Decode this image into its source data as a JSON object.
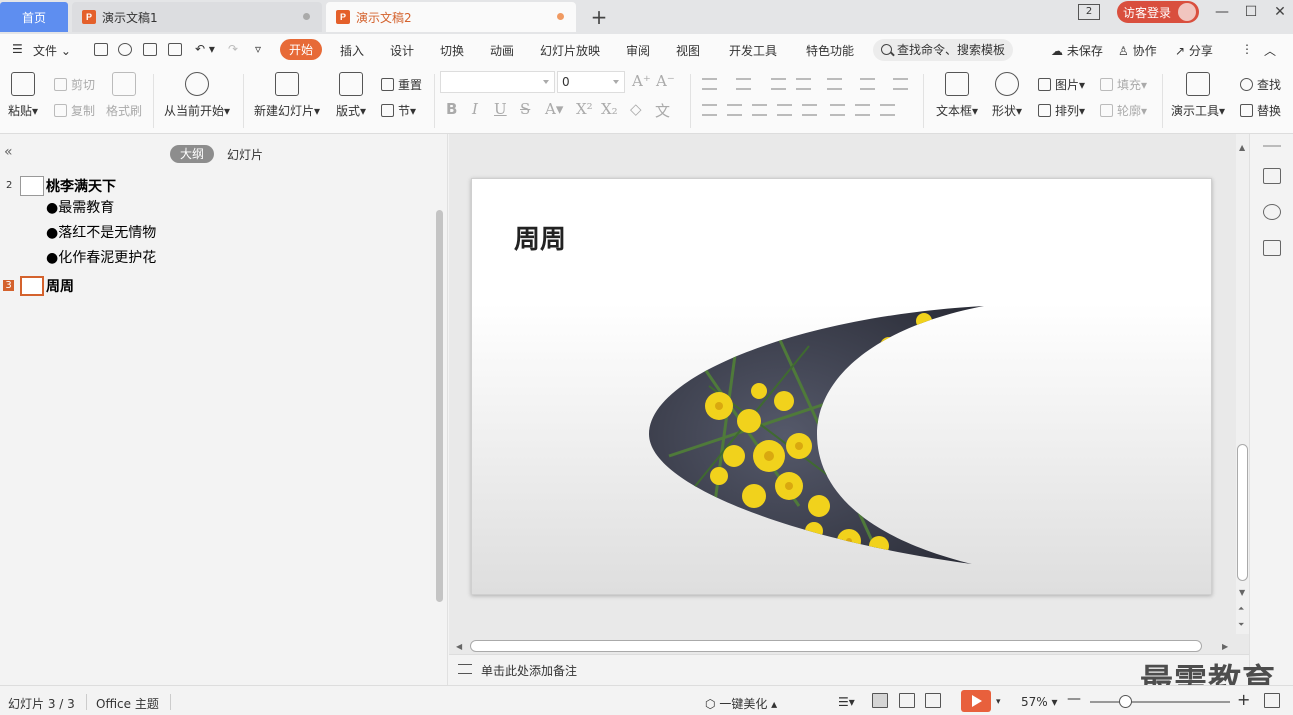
{
  "titlebar": {
    "home_tab": "首页",
    "tabs": [
      {
        "label": "演示文稿1",
        "icon": "presentation-icon"
      },
      {
        "label": "演示文稿2",
        "icon": "presentation-icon"
      }
    ],
    "add_tab": "+",
    "window_count": "2",
    "login": "访客登录"
  },
  "menu": {
    "file": "文件",
    "items": [
      "开始",
      "插入",
      "设计",
      "切换",
      "动画",
      "幻灯片放映",
      "审阅",
      "视图",
      "开发工具",
      "特色功能"
    ],
    "active": "开始",
    "search_placeholder": "查找命令、搜索模板",
    "unsaved": "未保存",
    "collaborate": "协作",
    "share": "分享"
  },
  "ribbon": {
    "paste": "粘贴",
    "cut": "剪切",
    "copy": "复制",
    "format_painter": "格式刷",
    "from_current": "从当前开始",
    "new_slide": "新建幻灯片",
    "layout": "版式",
    "reset": "重置",
    "section": "节",
    "font_name": "",
    "font_size": "0",
    "text_box": "文本框",
    "shape": "形状",
    "picture": "图片",
    "arrange": "排列",
    "fill": "填充",
    "outline": "轮廓",
    "present_tools": "演示工具",
    "find": "查找",
    "replace": "替换"
  },
  "outline": {
    "tab_outline": "大纲",
    "tab_slides": "幻灯片",
    "slides": [
      {
        "num": "2",
        "title": "桃李满天下",
        "bullets": [
          "●最需教育",
          "●落红不是无情物",
          "●化作春泥更护花"
        ]
      },
      {
        "num": "3",
        "title": "周周",
        "bullets": []
      }
    ]
  },
  "slide": {
    "title": "周周"
  },
  "notes": {
    "placeholder": "单击此处添加备注"
  },
  "watermark": "最需教育",
  "status": {
    "slide_info": "幻灯片 3 / 3",
    "theme": "Office 主题",
    "beautify": "一键美化",
    "zoom": "57%"
  },
  "colors": {
    "accent": "#e4602b",
    "home_tab": "#5e8ef0",
    "login": "#d94f3e"
  }
}
